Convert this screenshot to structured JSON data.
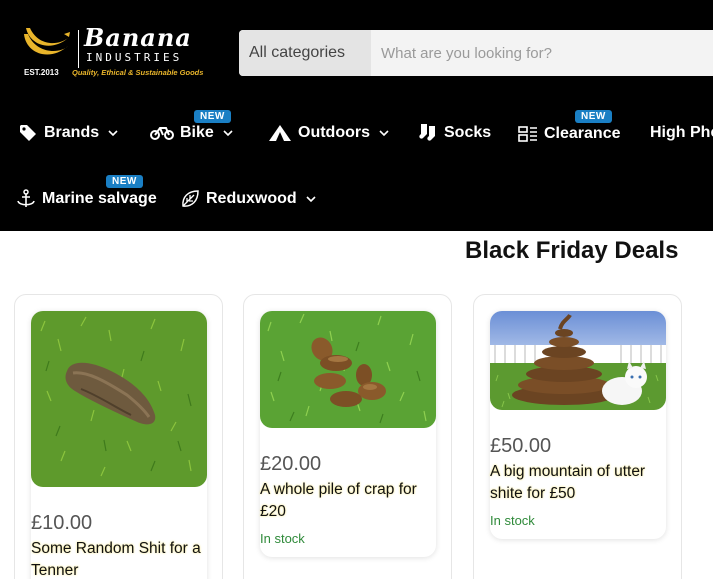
{
  "brand": {
    "name": "Banana",
    "subtitle": "INDUSTRIES",
    "est": "EST.2013",
    "tagline": "Quality, Ethical & Sustainable Goods"
  },
  "search": {
    "category_label": "All categories",
    "placeholder": "What are you looking for?"
  },
  "nav": {
    "brands": "Brands",
    "bike": "Bike",
    "outdoors": "Outdoors",
    "socks": "Socks",
    "clearance": "Clearance",
    "high_phe": "High Phe",
    "marine_salvage": "Marine salvage",
    "reduxwood": "Reduxwood",
    "new_badge": "NEW"
  },
  "section_title": "Black Friday Deals",
  "products": [
    {
      "price": "£10.00",
      "name": "Some Random Shit for a Tenner",
      "stock": ""
    },
    {
      "price": "£20.00",
      "name": "A whole pile of crap for £20",
      "stock": "In stock"
    },
    {
      "price": "£50.00",
      "name": "A big mountain of utter shite for £50",
      "stock": "In stock"
    }
  ],
  "colors": {
    "header_bg": "#000000",
    "badge": "#1a7fc4",
    "stock_green": "#2f8a3a",
    "tagline_gold": "#e9b52b"
  }
}
